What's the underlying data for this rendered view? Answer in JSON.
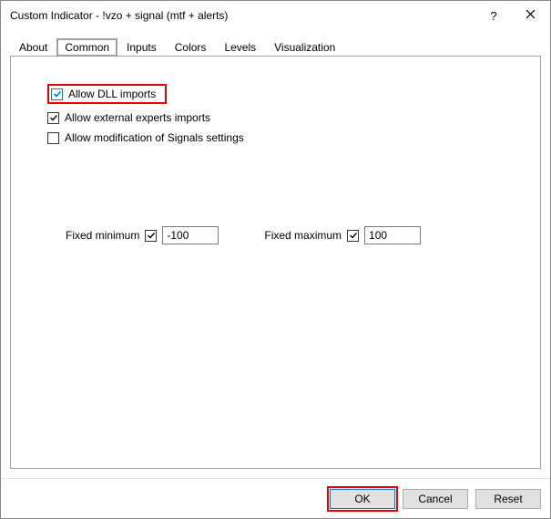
{
  "window": {
    "title": "Custom Indicator - !vzo + signal (mtf + alerts)",
    "help_symbol": "?",
    "close_label": "Close"
  },
  "tabs": {
    "about": "About",
    "common": "Common",
    "inputs": "Inputs",
    "colors": "Colors",
    "levels": "Levels",
    "visualization": "Visualization",
    "active": "common"
  },
  "options": {
    "allow_dll": {
      "label": "Allow DLL imports",
      "checked": true
    },
    "allow_ext_experts": {
      "label": "Allow external experts imports",
      "checked": true
    },
    "allow_mod_signals": {
      "label": "Allow modification of Signals settings",
      "checked": false
    }
  },
  "fixed": {
    "min_label": "Fixed minimum",
    "min_checked": true,
    "min_value": "-100",
    "max_label": "Fixed maximum",
    "max_checked": true,
    "max_value": "100"
  },
  "buttons": {
    "ok": "OK",
    "cancel": "Cancel",
    "reset": "Reset"
  },
  "highlight": {
    "tab_common": true,
    "allow_dll": true,
    "ok_button": true
  }
}
